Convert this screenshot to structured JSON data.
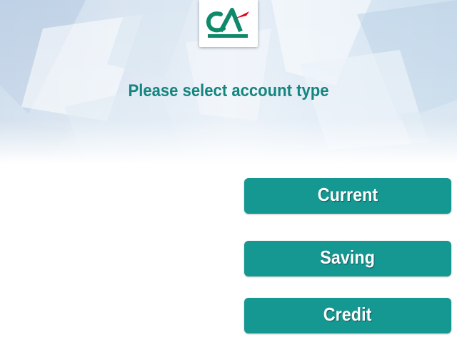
{
  "screen": {
    "title": "Please select account type"
  },
  "logo": {
    "icon": "credit-agricole-logo",
    "text": "CA"
  },
  "buttons": {
    "current": "Current",
    "saving": "Saving",
    "credit": "Credit"
  },
  "colors": {
    "accent": "#159792",
    "title": "#14857f",
    "logo_green": "#0e8a6a",
    "logo_red": "#e2001a"
  }
}
